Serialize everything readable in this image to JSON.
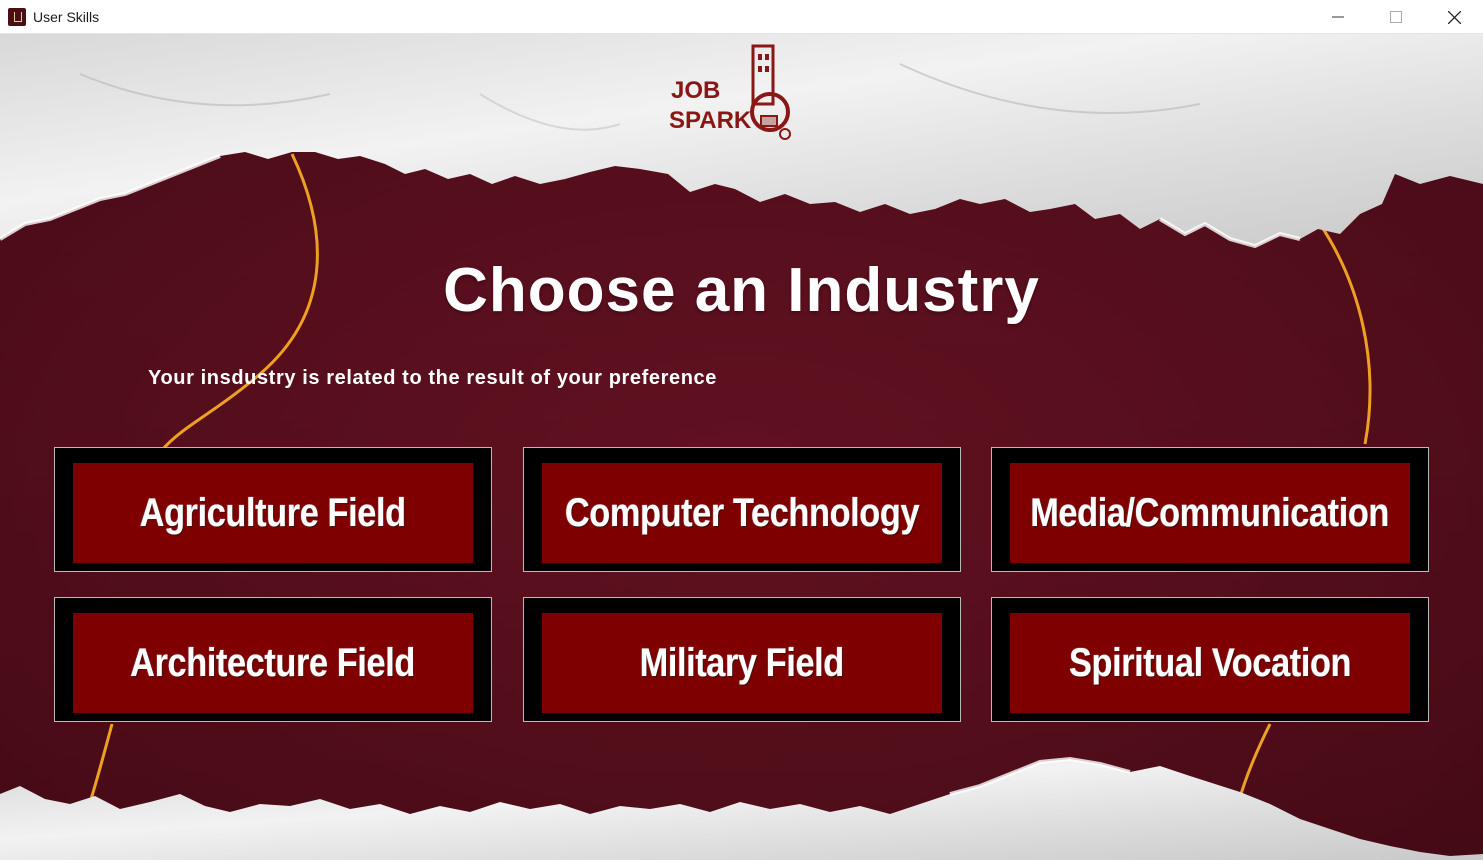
{
  "window": {
    "title": "User Skills",
    "app_icon": "java-cup-icon",
    "controls": [
      "minimize-icon",
      "maximize-icon",
      "close-icon"
    ]
  },
  "logo": {
    "line1": "JOB",
    "line2": "SPARK"
  },
  "heading": "Choose an Industry",
  "subheading": "Your insdustry is related to the result of your preference",
  "industries": [
    {
      "label": "Agriculture Field"
    },
    {
      "label": "Computer Technology"
    },
    {
      "label": "Media/Communication"
    },
    {
      "label": "Architecture Field"
    },
    {
      "label": "Military Field"
    },
    {
      "label": "Spiritual Vocation"
    }
  ],
  "colors": {
    "background": "#5a0f1f",
    "button_fill": "#7e0000",
    "button_frame": "#000000",
    "accent_line": "#f0a020",
    "paper": "#ececec",
    "logo": "#8a1616"
  }
}
